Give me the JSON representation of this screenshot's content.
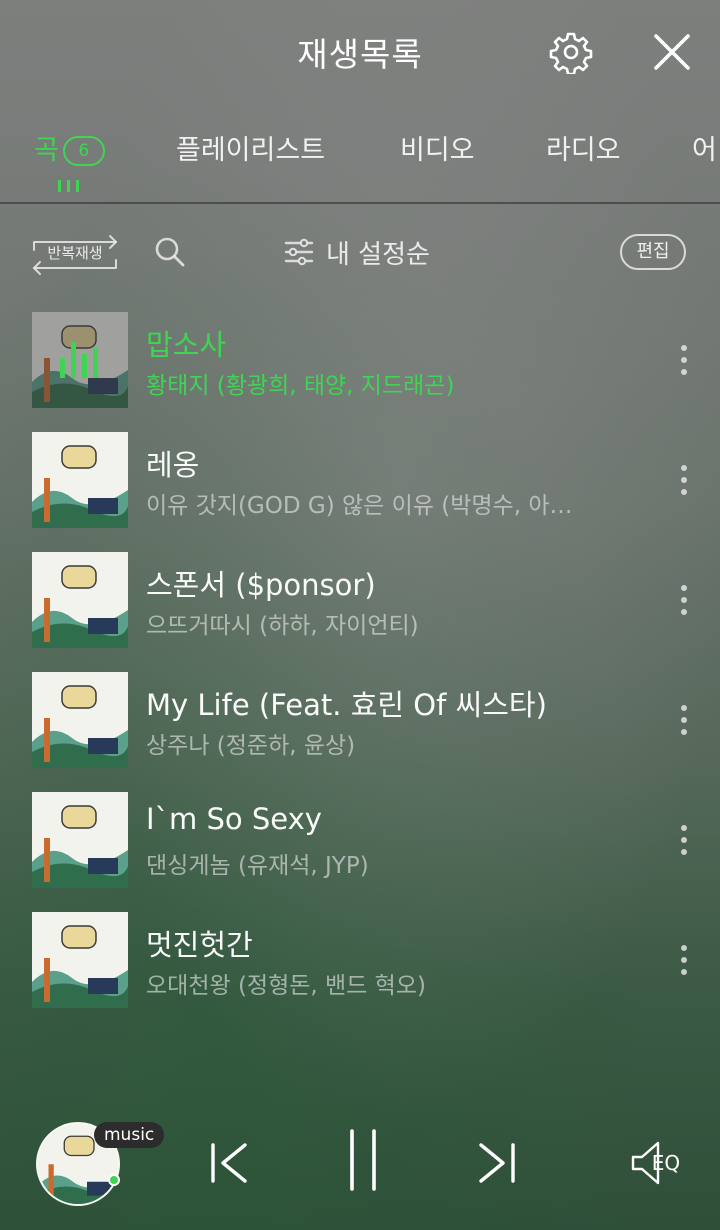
{
  "header": {
    "title": "재생목록",
    "settings_icon": "gear-icon",
    "close_icon": "close-icon"
  },
  "tabs": [
    {
      "label": "곡",
      "badge": "6",
      "active": true
    },
    {
      "label": "플레이리스트"
    },
    {
      "label": "비디오"
    },
    {
      "label": "라디오"
    },
    {
      "label": "어"
    }
  ],
  "toolbar": {
    "repeat_label": "반복재생",
    "sort_label": "내 설정순",
    "edit_label": "편집"
  },
  "songs": [
    {
      "title": "맙소사",
      "artist": "황태지 (황광희, 태양, 지드래곤)",
      "playing": true
    },
    {
      "title": "레옹",
      "artist": "이유 갓지(GOD G) 않은 이유 (박명수, 아…"
    },
    {
      "title": "스폰서 ($ponsor)",
      "artist": "으뜨거따시 (하하, 자이언티)"
    },
    {
      "title": "My Life (Feat. 효린 Of 씨스타)",
      "artist": "상주나 (정준하, 윤상)"
    },
    {
      "title": "I`m So Sexy",
      "artist": "댄싱게놈 (유재석, JYP)"
    },
    {
      "title": "멋진헛간",
      "artist": "오대천왕 (정형돈, 밴드 혁오)"
    }
  ],
  "player": {
    "tag": "music",
    "eq_label": "EQ"
  },
  "colors": {
    "accent": "#3fd454"
  }
}
